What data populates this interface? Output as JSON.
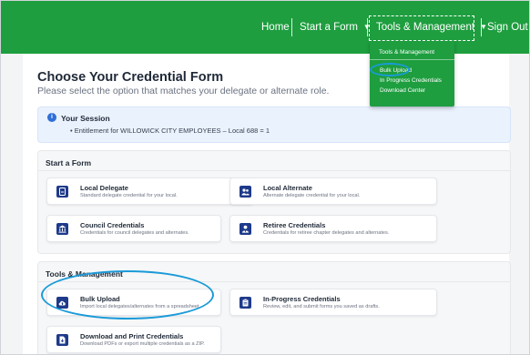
{
  "nav": {
    "home": "Home",
    "start_form": "Start a Form",
    "tools": "Tools & Management",
    "sign_out": "Sign Out",
    "caret": "▼"
  },
  "dropdown": {
    "header": "Tools & Management",
    "items": [
      "Bulk Upload",
      "In Progress Credentials",
      "Download Center"
    ]
  },
  "page": {
    "title": "Choose Your Credential Form",
    "subtitle": "Please select the option that matches your delegate or alternate role."
  },
  "session": {
    "icon_glyph": "i",
    "title": "Your Session",
    "bullet": "•  Entitlement for WILLOWICK CITY EMPLOYEES – Local 688 = 1"
  },
  "start_form": {
    "heading": "Start a Form",
    "tiles": [
      {
        "title": "Local Delegate",
        "desc": "Standard delegate credential for your local.",
        "icon": "badge-icon"
      },
      {
        "title": "Local Alternate",
        "desc": "Alternate delegate credential for your local.",
        "icon": "users-icon"
      },
      {
        "title": "Council Credentials",
        "desc": "Credentials for council delegates and alternates.",
        "icon": "building-columns-icon"
      },
      {
        "title": "Retiree Credentials",
        "desc": "Credentials for retiree chapter delegates and alternates.",
        "icon": "user-tie-icon"
      }
    ]
  },
  "tools_section": {
    "heading": "Tools & Management",
    "tiles": [
      {
        "title": "Bulk Upload",
        "desc": "Import local delegates/alternates from a spreadsheet.",
        "icon": "cloud-upload-icon"
      },
      {
        "title": "In-Progress Credentials",
        "desc": "Review, edit, and submit forms you saved as drafts.",
        "icon": "clipboard-icon"
      },
      {
        "title": "Download and Print Credentials",
        "desc": "Download PDFs or export multiple credentials as a ZIP.",
        "icon": "file-download-icon"
      }
    ]
  },
  "colors": {
    "brand_green": "#1e9e3f",
    "icon_navy": "#1e3a8a",
    "highlight_ring": "#1a9ad8",
    "info_blue": "#2f6fd6"
  }
}
